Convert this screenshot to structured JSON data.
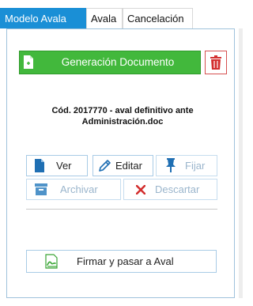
{
  "tabs": [
    {
      "label": "Modelo Avala",
      "active": true
    },
    {
      "label": "Avala",
      "active": false
    },
    {
      "label": "Cancelación",
      "active": false
    }
  ],
  "generate": {
    "label": "Generación Documento",
    "icon": "document-plus-icon"
  },
  "delete": {
    "icon": "trash-icon",
    "color": "#d32f2f"
  },
  "document": {
    "line1": "Cód. 2017770 - aval definitivo ante",
    "line2": "Administración.doc"
  },
  "actions": {
    "ver": {
      "label": "Ver",
      "icon": "document-icon",
      "enabled": true
    },
    "editar": {
      "label": "Editar",
      "icon": "pencil-icon",
      "enabled": true
    },
    "fijar": {
      "label": "Fijar",
      "icon": "pin-icon",
      "enabled": false
    },
    "archivar": {
      "label": "Archivar",
      "icon": "archive-icon",
      "enabled": false
    },
    "descartar": {
      "label": "Descartar",
      "icon": "x-icon",
      "enabled": false
    }
  },
  "sign": {
    "label": "Firmar y pasar a Aval",
    "icon": "signature-icon"
  },
  "colors": {
    "accent": "#1a8fd6",
    "green": "#42b83c",
    "red": "#d32f2f",
    "icon_blue": "#1f6fb3",
    "disabled": "#9ab5cc"
  }
}
